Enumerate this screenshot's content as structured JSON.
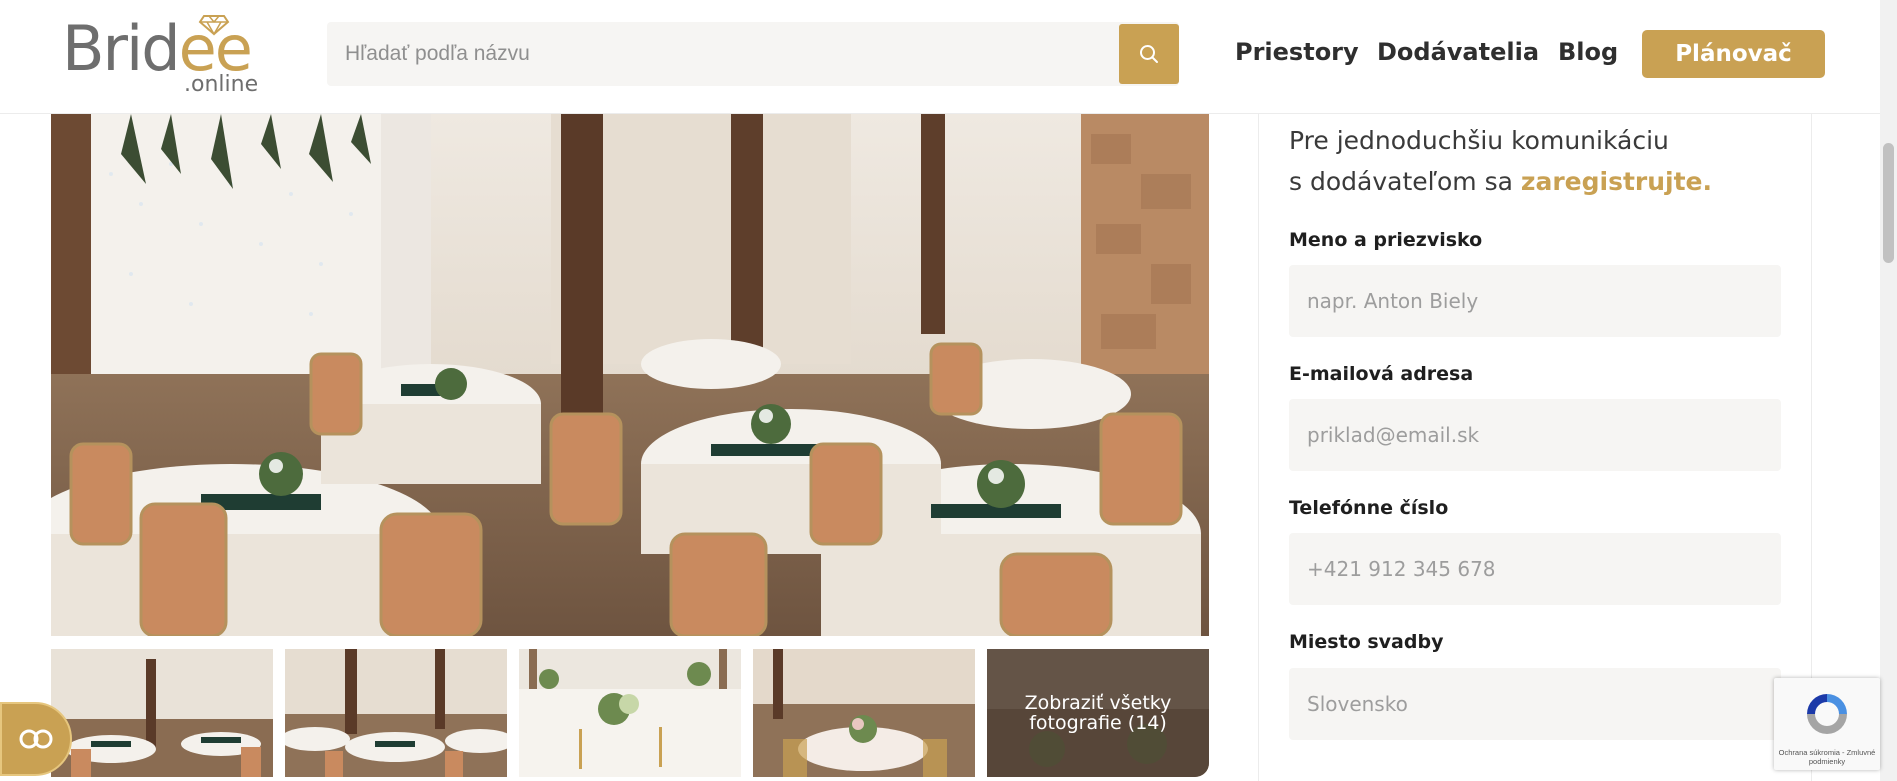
{
  "header": {
    "logo_text_a": "Brid",
    "logo_text_b": "ee",
    "logo_sub": ".online",
    "search_placeholder": "Hľadať podľa názvu",
    "nav": [
      "Priestory",
      "Dodávatelia",
      "Blog"
    ],
    "cta_label": "Plánovač"
  },
  "gallery": {
    "more_label": "Zobraziť všetky fotografie (14)"
  },
  "form": {
    "intro_line1": "Pre jednoduchšiu komunikáciu",
    "intro_line2": "s dodávateľom sa",
    "intro_link": "zaregistrujte.",
    "fields": [
      {
        "label": "Meno a priezvisko",
        "placeholder": "napr. Anton Biely",
        "value": ""
      },
      {
        "label": "E-mailová adresa",
        "placeholder": "priklad@email.sk",
        "value": ""
      },
      {
        "label": "Telefónne číslo",
        "placeholder": "+421 912 345 678",
        "value": ""
      },
      {
        "label": "Miesto svadby",
        "placeholder": "Slovensko",
        "value": ""
      }
    ]
  },
  "recaptcha": {
    "text": "Ochrana súkromia - Zmluvné podmienky"
  },
  "colors": {
    "accent": "#c9a153",
    "text_dark": "#2b2b2b",
    "field_bg": "#f6f5f3"
  },
  "icons": {
    "search": "search-icon",
    "cookie": "cookie-settings-icon",
    "recaptcha": "recaptcha-icon",
    "ring": "diamond-ring-icon"
  }
}
